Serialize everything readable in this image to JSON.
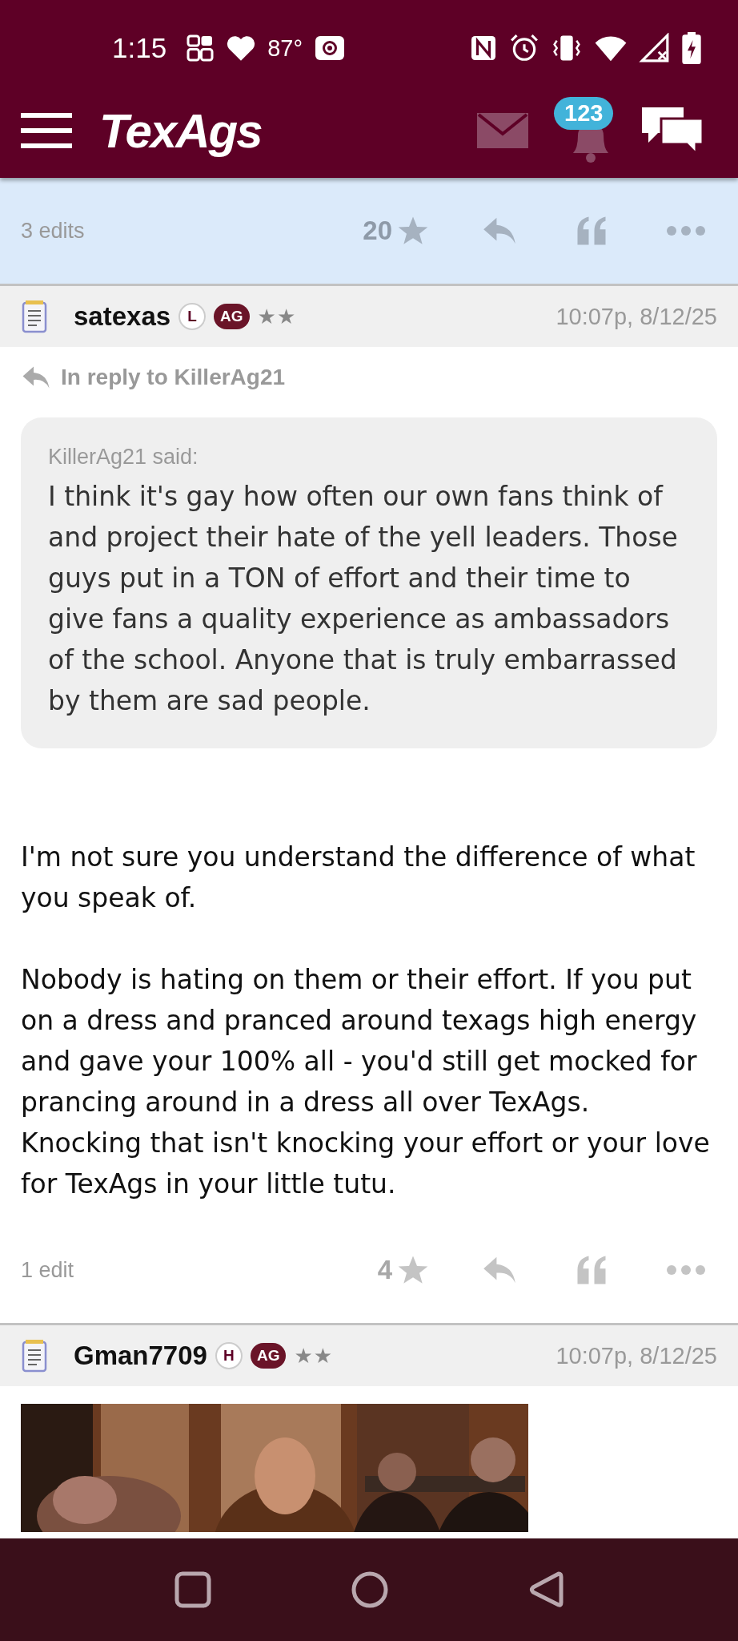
{
  "status_bar": {
    "time": "1:15",
    "temperature": "87°"
  },
  "header": {
    "logo": "TexAgs",
    "notification_count": "123"
  },
  "posts": [
    {
      "highlighted": true,
      "edits": "3 edits",
      "rating": "20"
    },
    {
      "highlighted": false,
      "author": "satexas",
      "role_badge": "L",
      "school_badge": "AG",
      "rank": "★★",
      "time": "10:07p, 8/12/25",
      "reply_to": "In reply to KillerAg21",
      "quote": {
        "author": "KillerAg21 said:",
        "text": "I think it's gay how often our own fans think of and project their hate of the yell leaders. Those guys put in a TON of effort and their time to give fans a quality experience as ambassadors of the school. Anyone that is truly embarrassed by them are sad people."
      },
      "paragraphs": [
        "I'm not sure you understand the difference of what you speak of.",
        "Nobody is hating on them or their effort. If you put on a dress and pranced around texags high energy and gave your 100% all - you'd still get mocked for prancing around in a dress all over TexAgs. Knocking that isn't knocking your effort or your love for TexAgs in your little tutu."
      ],
      "edits": "1 edit",
      "rating": "4"
    },
    {
      "author": "Gman7709",
      "role_badge": "H",
      "school_badge": "AG",
      "rank": "★★",
      "time": "10:07p, 8/12/25"
    }
  ]
}
